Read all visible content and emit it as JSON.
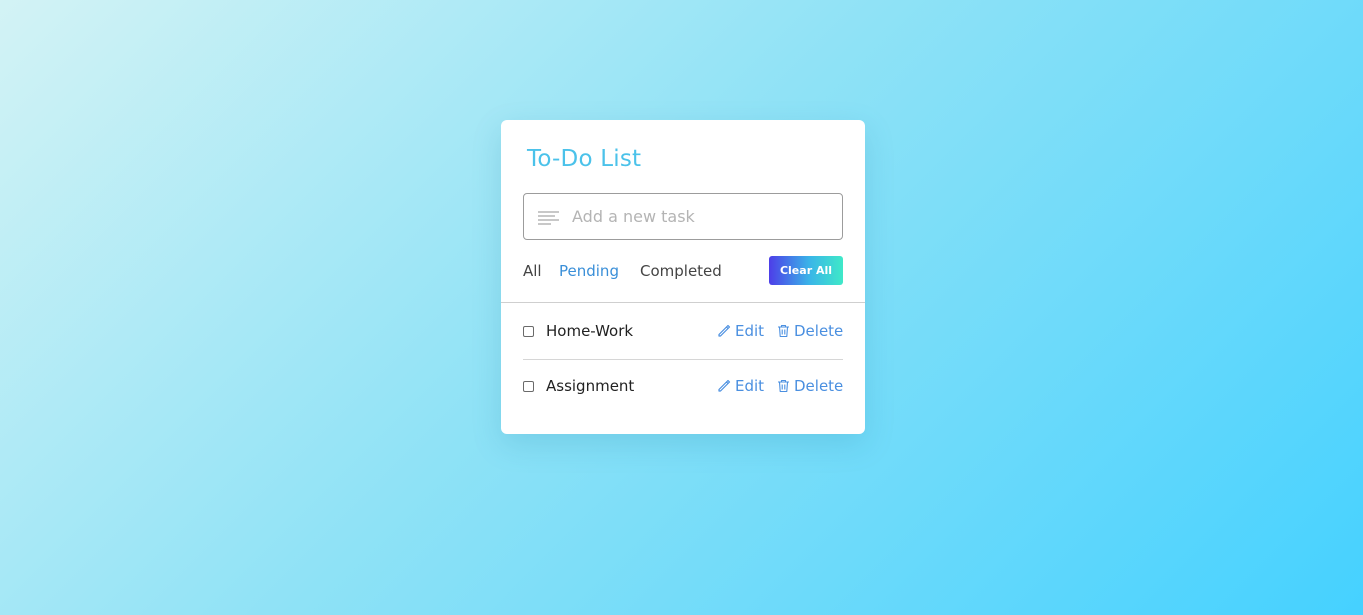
{
  "app": {
    "title": "To-Do List"
  },
  "input": {
    "placeholder": "Add a new task",
    "value": "",
    "icon": "lines-icon"
  },
  "filters": [
    {
      "label": "All",
      "active": false
    },
    {
      "label": "Pending",
      "active": true
    },
    {
      "label": "Completed",
      "active": false
    }
  ],
  "clear_button": {
    "label": "Clear All"
  },
  "tasks": [
    {
      "name": "Home-Work",
      "checked": false,
      "edit_label": "Edit",
      "delete_label": "Delete"
    },
    {
      "name": "Assignment",
      "checked": false,
      "edit_label": "Edit",
      "delete_label": "Delete"
    }
  ],
  "colors": {
    "title": "#4bc2ea",
    "active_filter": "#3a8fd8",
    "action": "#4a8fe0",
    "button_gradient_start": "#4d3ee8",
    "button_gradient_end": "#3fe9c8"
  }
}
